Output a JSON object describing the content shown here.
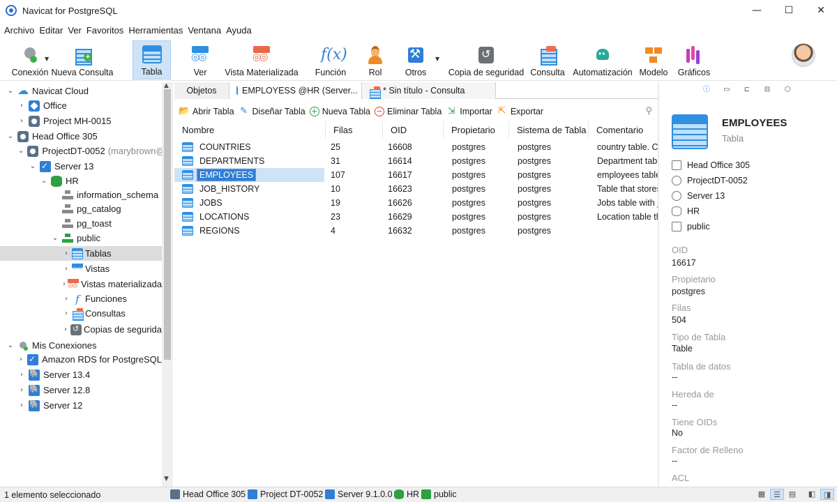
{
  "window": {
    "title": "Navicat for PostgreSQL",
    "minimize": "—",
    "maximize": "☐",
    "close": "✕"
  },
  "menu": [
    "Archivo",
    "Editar",
    "Ver",
    "Favoritos",
    "Herramientas",
    "Ventana",
    "Ayuda"
  ],
  "toolbar": {
    "conexion": "Conexión",
    "nueva_consulta": "Nueva Consulta",
    "tabla": "Tabla",
    "ver": "Ver",
    "vista_materializada": "Vista Materializada",
    "funcion": "Función",
    "rol": "Rol",
    "otros": "Otros",
    "copia_seguridad": "Copia de seguridad",
    "consulta": "Consulta",
    "automatizacion": "Automatización",
    "modelo": "Modelo",
    "graficos": "Gráficos",
    "active": "Tabla"
  },
  "tree": [
    {
      "label": "Navicat Cloud",
      "icon": "cloud-icon"
    },
    {
      "label": "Office",
      "icon": "project-icon"
    },
    {
      "label": "Project MH-0015",
      "icon": "project-icon"
    },
    {
      "label": "Head Office 305",
      "icon": "project-icon"
    },
    {
      "label": "ProjectDT-0052",
      "suffix": "(marybrown@",
      "icon": "project-icon"
    },
    {
      "label": "Server 13",
      "icon": "server-icon"
    },
    {
      "label": "HR",
      "icon": "database-icon"
    },
    {
      "label": "information_schema",
      "icon": "schema-icon"
    },
    {
      "label": "pg_catalog",
      "icon": "schema-icon"
    },
    {
      "label": "pg_toast",
      "icon": "schema-icon"
    },
    {
      "label": "public",
      "icon": "schema-icon"
    },
    {
      "label": "Tablas",
      "icon": "table-icon"
    },
    {
      "label": "Vistas",
      "icon": "view-icon"
    },
    {
      "label": "Vistas materializada",
      "icon": "materialized-view-icon"
    },
    {
      "label": "Funciones",
      "icon": "function-icon"
    },
    {
      "label": "Consultas",
      "icon": "query-icon"
    },
    {
      "label": "Copias de segurida",
      "icon": "backup-icon"
    },
    {
      "label": "Mis Conexiones",
      "icon": "connection-icon"
    },
    {
      "label": "Amazon RDS for PostgreSQL",
      "icon": "server-icon"
    },
    {
      "label": "Server 13.4",
      "icon": "postgres-icon"
    },
    {
      "label": "Server 12.8",
      "icon": "postgres-icon"
    },
    {
      "label": "Server 12",
      "icon": "postgres-icon"
    }
  ],
  "tabs": {
    "objects": "Objetos",
    "tab1": "EMPLOYESS @HR (Server...",
    "tab2": "* Sin título - Consulta"
  },
  "object_toolbar": {
    "abrir": "Abrir Tabla",
    "disenar": "Diseñar Tabla",
    "nueva": "Nueva Tabla",
    "eliminar": "Eliminar Tabla",
    "importar": "Importar",
    "exportar": "Exportar"
  },
  "grid": {
    "columns": [
      "Nombre",
      "Filas",
      "OID",
      "Propietario",
      "Sistema de Tabla",
      "Comentario"
    ],
    "rows": [
      {
        "name": "COUNTRIES",
        "rows": "25",
        "oid": "16608",
        "owner": "postgres",
        "system": "postgres",
        "comment": "country table. Co"
      },
      {
        "name": "DEPARTMENTS",
        "rows": "31",
        "oid": "16614",
        "owner": "postgres",
        "system": "postgres",
        "comment": "Department table"
      },
      {
        "name": "EMPLOYEES",
        "rows": "107",
        "oid": "16617",
        "owner": "postgres",
        "system": "postgres",
        "comment": "employees table."
      },
      {
        "name": "JOB_HISTORY",
        "rows": "10",
        "oid": "16623",
        "owner": "postgres",
        "system": "postgres",
        "comment": "Table that stores J"
      },
      {
        "name": "JOBS",
        "rows": "19",
        "oid": "16626",
        "owner": "postgres",
        "system": "postgres",
        "comment": "Jobs table with jo"
      },
      {
        "name": "LOCATIONS",
        "rows": "23",
        "oid": "16629",
        "owner": "postgres",
        "system": "postgres",
        "comment": "Location table tha"
      },
      {
        "name": "REGIONS",
        "rows": "4",
        "oid": "16632",
        "owner": "postgres",
        "system": "postgres",
        "comment": ""
      }
    ],
    "selected": "EMPLOYEES"
  },
  "info": {
    "title": "EMPLOYEES",
    "subtitle": "Tabla",
    "path": [
      "Head Office 305",
      "ProjectDT-0052",
      "Server 13",
      "HR",
      "public"
    ],
    "fields": [
      {
        "label": "OID",
        "value": "16617"
      },
      {
        "label": "Propietario",
        "value": "postgres"
      },
      {
        "label": "Filas",
        "value": "504"
      },
      {
        "label": "Tipo de Tabla",
        "value": "Table"
      },
      {
        "label": "Tabla de datos",
        "value": "--"
      },
      {
        "label": "Hereda de",
        "value": "--"
      },
      {
        "label": "Tiene OIDs",
        "value": "No"
      },
      {
        "label": "Factor de Relleno",
        "value": "--"
      },
      {
        "label": "ACL",
        "value": ""
      }
    ]
  },
  "status": {
    "text": "1 elemento seleccionado",
    "crumbs": [
      "Head Office 305",
      "Project DT-0052",
      "Server 9.1.0.0",
      "HR",
      "public"
    ]
  },
  "colors": {
    "accent": "#2f7fd6",
    "selection": "#cfe3f7"
  }
}
